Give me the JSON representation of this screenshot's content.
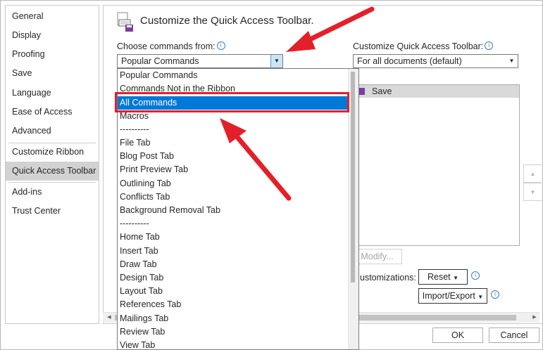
{
  "sidebar": {
    "items": [
      {
        "label": "General"
      },
      {
        "label": "Display"
      },
      {
        "label": "Proofing"
      },
      {
        "label": "Save"
      },
      {
        "label": "Language"
      },
      {
        "label": "Ease of Access"
      },
      {
        "label": "Advanced"
      },
      {
        "label": "Customize Ribbon"
      },
      {
        "label": "Quick Access Toolbar",
        "active": true
      },
      {
        "label": "Add-ins"
      },
      {
        "label": "Trust Center"
      }
    ]
  },
  "header": {
    "title": "Customize the Quick Access Toolbar."
  },
  "choose_commands": {
    "label": "Choose commands from:",
    "value": "Popular Commands",
    "options": [
      "Popular Commands",
      "Commands Not in the Ribbon",
      "All Commands",
      "Macros",
      "----------",
      "File Tab",
      "Blog Post Tab",
      "Print Preview Tab",
      "Outlining Tab",
      "Conflicts Tab",
      "Background Removal Tab",
      "----------",
      "Home Tab",
      "Insert Tab",
      "Draw Tab",
      "Design Tab",
      "Layout Tab",
      "References Tab",
      "Mailings Tab",
      "Review Tab",
      "View Tab"
    ],
    "highlighted": "All Commands"
  },
  "customize_toolbar": {
    "label": "Customize Quick Access Toolbar:",
    "value": "For all documents (default)",
    "items": [
      "Save"
    ]
  },
  "buttons": {
    "modify": "Modify...",
    "customizations_label": "ustomizations:",
    "reset": "Reset",
    "import_export": "Import/Export",
    "ok": "OK",
    "cancel": "Cancel"
  },
  "colors": {
    "accent": "#0078d7",
    "annotation": "#e3202a"
  }
}
